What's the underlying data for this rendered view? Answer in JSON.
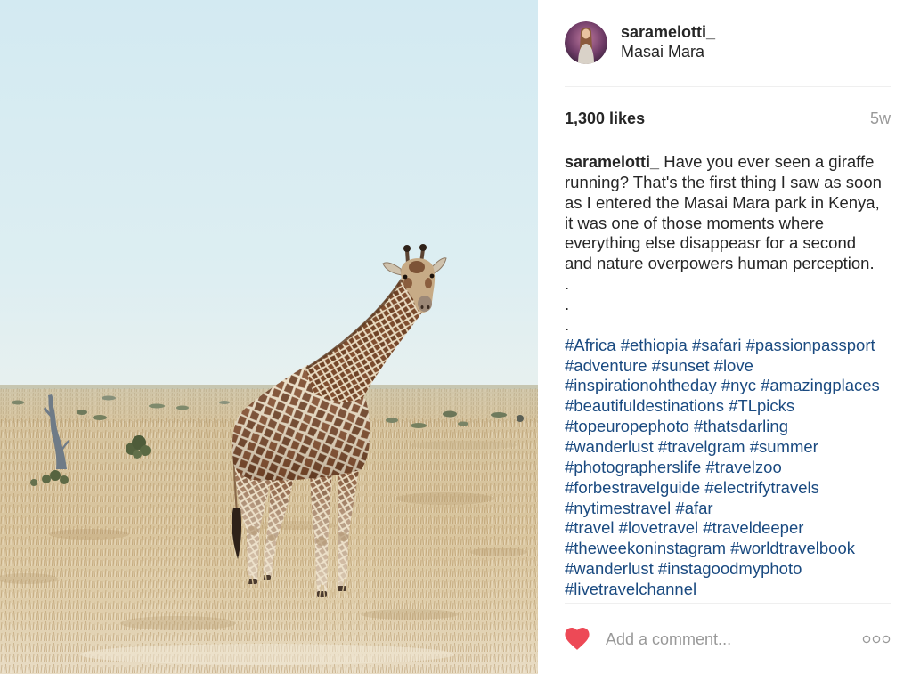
{
  "post": {
    "username": "saramelotti_",
    "location": "Masai Mara",
    "likes": "1,300 likes",
    "time_ago": "5w"
  },
  "caption": {
    "username": "saramelotti_",
    "lines": [
      "Have you ever seen a giraffe",
      "running? That's the first thing I saw as soon",
      "as I entered the Masai Mara park in Kenya,",
      "it was one of those moments where",
      "everything else disappeasr for a second",
      "and nature overpowers human perception.",
      ".",
      ".",
      "."
    ],
    "hashtag_lines": [
      [
        "#Africa",
        "#ethiopia",
        "#safari",
        "#passionpassport"
      ],
      [
        "#adventure",
        "#sunset",
        "#love"
      ],
      [
        "#inspirationohtheday",
        "#nyc",
        "#amazingplaces"
      ],
      [
        "#beautifuldestinations",
        "#TLpicks"
      ],
      [
        "#topeuropephoto",
        "#thatsdarling"
      ],
      [
        "#wanderlust",
        "#travelgram",
        "#summer"
      ],
      [
        "#photographerslife",
        "#travelzoo"
      ],
      [
        "#forbestravelguide",
        "#electrifytravels"
      ],
      [
        "#nytimestravel",
        "#afar"
      ],
      [
        "#travel",
        "#lovetravel",
        "#traveldeeper"
      ],
      [
        "#theweekoninstagram",
        "#worldtravelbook"
      ],
      [
        "#wanderlust",
        "#instagoodmyphoto"
      ],
      [
        "#livetravelchannel"
      ]
    ]
  },
  "comment_bar": {
    "placeholder": "Add a comment...",
    "like_icon": "heart-icon",
    "options_icon": "more-options-icon"
  },
  "colors": {
    "text": "#262626",
    "muted": "#999999",
    "hashtag": "#1a4a80",
    "like": "#ed4956",
    "divider": "#efefef"
  }
}
